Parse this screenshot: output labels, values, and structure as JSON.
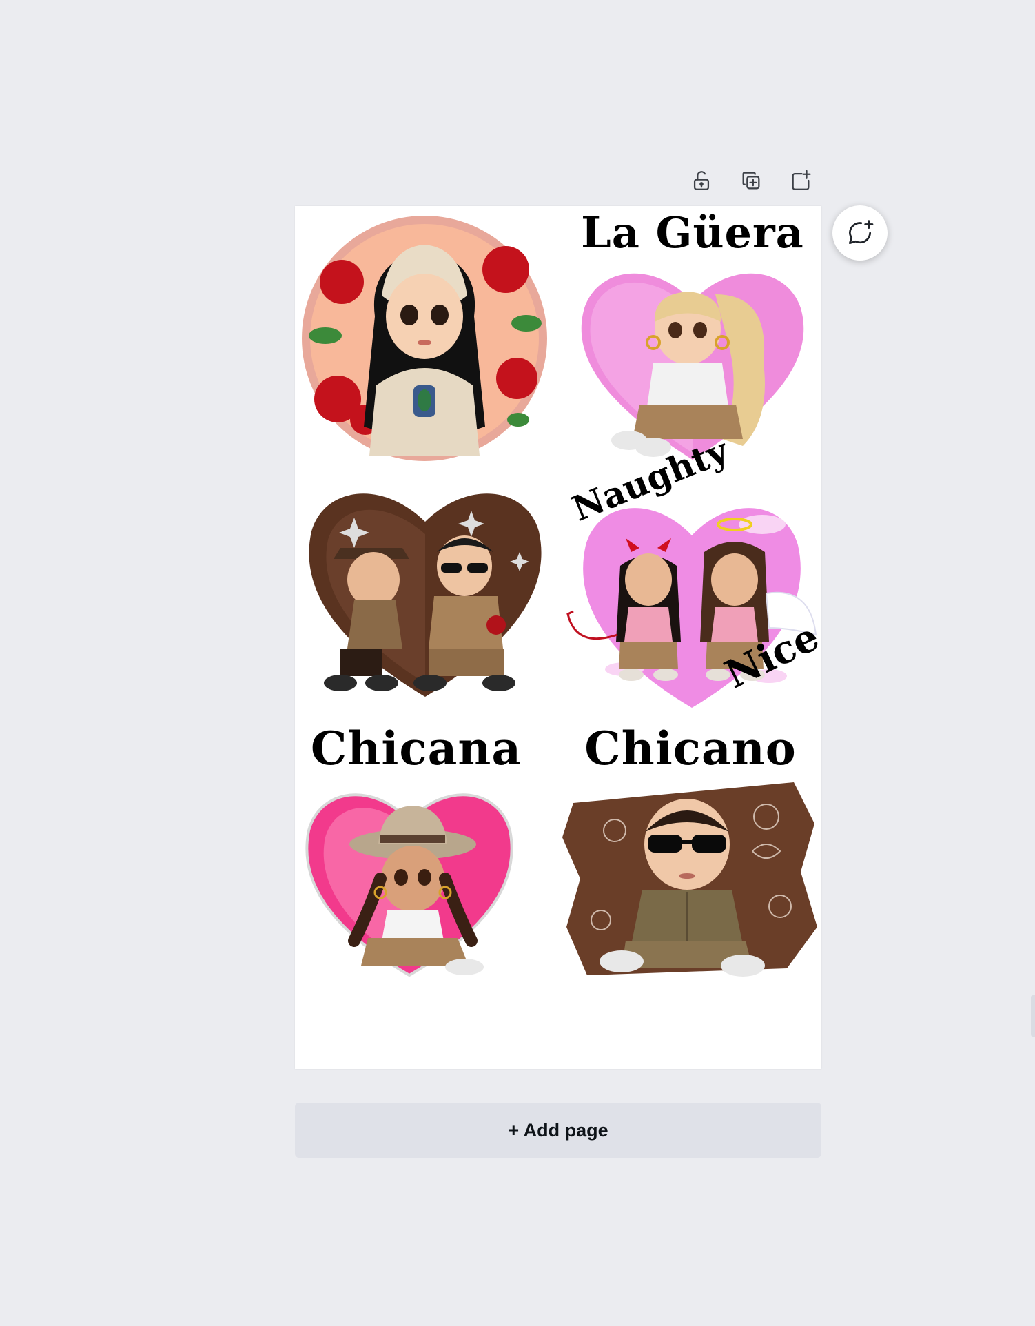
{
  "toolbar": {
    "lock_icon": "unlock-icon",
    "duplicate_icon": "duplicate-page-icon",
    "add_icon": "add-page-icon"
  },
  "comment_icon": "comment-add-icon",
  "stickers": {
    "la_guera": {
      "title": "La Güera"
    },
    "naughty_nice": {
      "top": "Naughty",
      "bottom": "Nice"
    },
    "chicana": {
      "title": "Chicana"
    },
    "chicano": {
      "title": "Chicano"
    }
  },
  "add_page": {
    "label": "+ Add page"
  },
  "colors": {
    "canvas_bg": "#ebecf0",
    "page_bg": "#ffffff",
    "add_page_bg": "#dfe1e8",
    "peach": "#f7b596",
    "pink": "#ef8cdc",
    "hot_pink": "#f23a8c",
    "brown": "#5a3320",
    "khaki": "#a9835a"
  }
}
